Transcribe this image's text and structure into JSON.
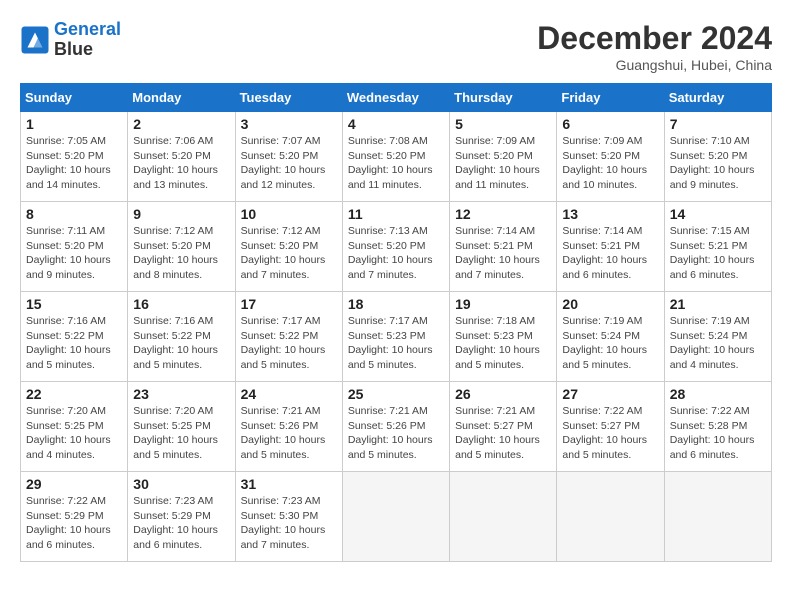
{
  "header": {
    "logo_line1": "General",
    "logo_line2": "Blue",
    "month": "December 2024",
    "location": "Guangshui, Hubei, China"
  },
  "days_of_week": [
    "Sunday",
    "Monday",
    "Tuesday",
    "Wednesday",
    "Thursday",
    "Friday",
    "Saturday"
  ],
  "weeks": [
    [
      {
        "day": "1",
        "info": "Sunrise: 7:05 AM\nSunset: 5:20 PM\nDaylight: 10 hours and 14 minutes."
      },
      {
        "day": "2",
        "info": "Sunrise: 7:06 AM\nSunset: 5:20 PM\nDaylight: 10 hours and 13 minutes."
      },
      {
        "day": "3",
        "info": "Sunrise: 7:07 AM\nSunset: 5:20 PM\nDaylight: 10 hours and 12 minutes."
      },
      {
        "day": "4",
        "info": "Sunrise: 7:08 AM\nSunset: 5:20 PM\nDaylight: 10 hours and 11 minutes."
      },
      {
        "day": "5",
        "info": "Sunrise: 7:09 AM\nSunset: 5:20 PM\nDaylight: 10 hours and 11 minutes."
      },
      {
        "day": "6",
        "info": "Sunrise: 7:09 AM\nSunset: 5:20 PM\nDaylight: 10 hours and 10 minutes."
      },
      {
        "day": "7",
        "info": "Sunrise: 7:10 AM\nSunset: 5:20 PM\nDaylight: 10 hours and 9 minutes."
      }
    ],
    [
      {
        "day": "8",
        "info": "Sunrise: 7:11 AM\nSunset: 5:20 PM\nDaylight: 10 hours and 9 minutes."
      },
      {
        "day": "9",
        "info": "Sunrise: 7:12 AM\nSunset: 5:20 PM\nDaylight: 10 hours and 8 minutes."
      },
      {
        "day": "10",
        "info": "Sunrise: 7:12 AM\nSunset: 5:20 PM\nDaylight: 10 hours and 7 minutes."
      },
      {
        "day": "11",
        "info": "Sunrise: 7:13 AM\nSunset: 5:20 PM\nDaylight: 10 hours and 7 minutes."
      },
      {
        "day": "12",
        "info": "Sunrise: 7:14 AM\nSunset: 5:21 PM\nDaylight: 10 hours and 7 minutes."
      },
      {
        "day": "13",
        "info": "Sunrise: 7:14 AM\nSunset: 5:21 PM\nDaylight: 10 hours and 6 minutes."
      },
      {
        "day": "14",
        "info": "Sunrise: 7:15 AM\nSunset: 5:21 PM\nDaylight: 10 hours and 6 minutes."
      }
    ],
    [
      {
        "day": "15",
        "info": "Sunrise: 7:16 AM\nSunset: 5:22 PM\nDaylight: 10 hours and 5 minutes."
      },
      {
        "day": "16",
        "info": "Sunrise: 7:16 AM\nSunset: 5:22 PM\nDaylight: 10 hours and 5 minutes."
      },
      {
        "day": "17",
        "info": "Sunrise: 7:17 AM\nSunset: 5:22 PM\nDaylight: 10 hours and 5 minutes."
      },
      {
        "day": "18",
        "info": "Sunrise: 7:17 AM\nSunset: 5:23 PM\nDaylight: 10 hours and 5 minutes."
      },
      {
        "day": "19",
        "info": "Sunrise: 7:18 AM\nSunset: 5:23 PM\nDaylight: 10 hours and 5 minutes."
      },
      {
        "day": "20",
        "info": "Sunrise: 7:19 AM\nSunset: 5:24 PM\nDaylight: 10 hours and 5 minutes."
      },
      {
        "day": "21",
        "info": "Sunrise: 7:19 AM\nSunset: 5:24 PM\nDaylight: 10 hours and 4 minutes."
      }
    ],
    [
      {
        "day": "22",
        "info": "Sunrise: 7:20 AM\nSunset: 5:25 PM\nDaylight: 10 hours and 4 minutes."
      },
      {
        "day": "23",
        "info": "Sunrise: 7:20 AM\nSunset: 5:25 PM\nDaylight: 10 hours and 5 minutes."
      },
      {
        "day": "24",
        "info": "Sunrise: 7:21 AM\nSunset: 5:26 PM\nDaylight: 10 hours and 5 minutes."
      },
      {
        "day": "25",
        "info": "Sunrise: 7:21 AM\nSunset: 5:26 PM\nDaylight: 10 hours and 5 minutes."
      },
      {
        "day": "26",
        "info": "Sunrise: 7:21 AM\nSunset: 5:27 PM\nDaylight: 10 hours and 5 minutes."
      },
      {
        "day": "27",
        "info": "Sunrise: 7:22 AM\nSunset: 5:27 PM\nDaylight: 10 hours and 5 minutes."
      },
      {
        "day": "28",
        "info": "Sunrise: 7:22 AM\nSunset: 5:28 PM\nDaylight: 10 hours and 6 minutes."
      }
    ],
    [
      {
        "day": "29",
        "info": "Sunrise: 7:22 AM\nSunset: 5:29 PM\nDaylight: 10 hours and 6 minutes."
      },
      {
        "day": "30",
        "info": "Sunrise: 7:23 AM\nSunset: 5:29 PM\nDaylight: 10 hours and 6 minutes."
      },
      {
        "day": "31",
        "info": "Sunrise: 7:23 AM\nSunset: 5:30 PM\nDaylight: 10 hours and 7 minutes."
      },
      {
        "day": "",
        "info": ""
      },
      {
        "day": "",
        "info": ""
      },
      {
        "day": "",
        "info": ""
      },
      {
        "day": "",
        "info": ""
      }
    ]
  ]
}
